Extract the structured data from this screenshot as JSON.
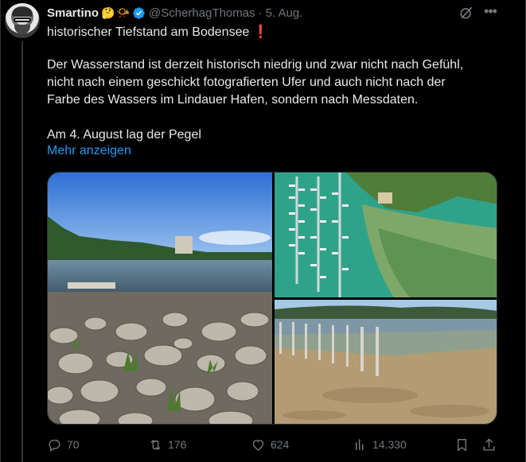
{
  "author": {
    "name": "Smartino",
    "emojis": [
      "🤔",
      "📯"
    ],
    "handle": "@ScherhagThomas",
    "separator": "·",
    "date": "5. Aug."
  },
  "tweet": {
    "headline": "historischer Tiefstand am Bodensee",
    "headline_emoji": "❗",
    "lines": [
      "Der Wasserstand ist derzeit historisch niedrig und zwar nicht nach Gefühl,",
      "nicht nach einem geschickt fotografierten Ufer und auch nicht nach der",
      "Farbe des Wassers im Lindauer Hafen, sondern nach Messdaten."
    ],
    "last_line": "Am 4. August lag der Pegel",
    "show_more": "Mehr anzeigen"
  },
  "actions": {
    "replies": "70",
    "reposts": "176",
    "likes": "624",
    "views": "14.330"
  },
  "colors": {
    "background": "#000000",
    "text": "#e7e9ea",
    "muted": "#71767b",
    "accent": "#1d9bf0"
  },
  "icons": [
    "grok-icon",
    "more-icon",
    "verified-icon",
    "reply-icon",
    "repost-icon",
    "like-icon",
    "views-icon",
    "bookmark-icon",
    "share-icon"
  ]
}
